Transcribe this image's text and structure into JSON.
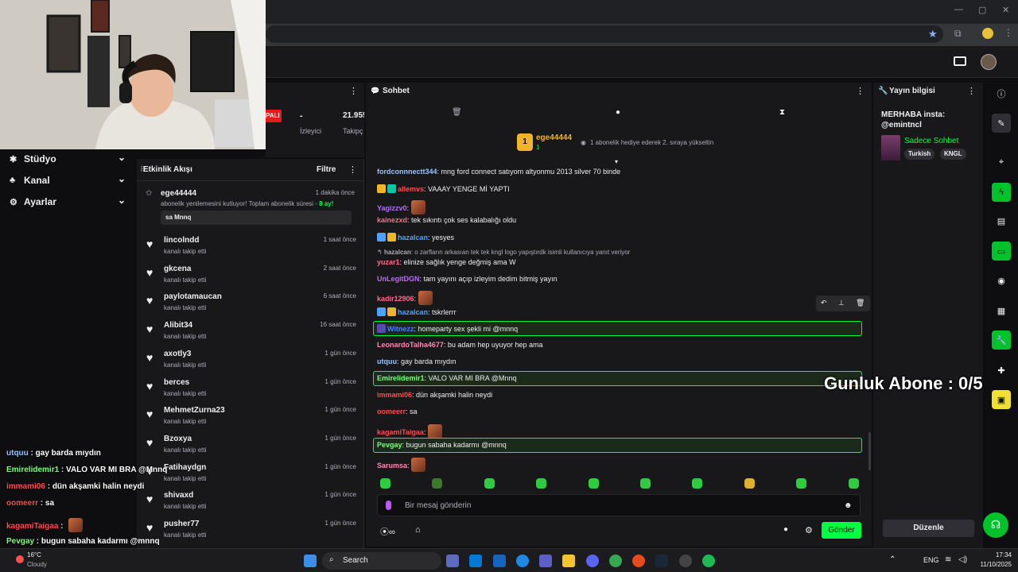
{
  "colors": {
    "accent": "#00ff40",
    "accent_btn": "#00c22a",
    "bg": "#18181b",
    "bg_dark": "#0e0e10"
  },
  "browser": {
    "window_controls": [
      "—",
      "▢",
      "✕"
    ]
  },
  "stats": {
    "live_badge": "PALI",
    "viewers_value": "-",
    "viewers_label": "İzleyici",
    "followers_value": "21.955",
    "followers_label": "Takipç"
  },
  "leftnav": {
    "items": [
      {
        "label": "Stüdyo",
        "icon": "studio-icon"
      },
      {
        "label": "Kanal",
        "icon": "channel-icon"
      },
      {
        "label": "Ayarlar",
        "icon": "gear-icon"
      }
    ]
  },
  "feed": {
    "title": "Etkinlik Akışı",
    "filter_label": "Filtre",
    "sub_event": {
      "name": "ege44444",
      "time": "1 dakika önce",
      "message_prefix": "abonelik yenilemesini kutluyor! Toplam abonelik süresi - ",
      "months": "8 ay!",
      "quote": "sa Mnnq"
    },
    "follows": [
      {
        "name": "lincolndd",
        "sub": "kanalı takip etti",
        "time": "1 saat önce"
      },
      {
        "name": "gkcena",
        "sub": "kanalı takip etti",
        "time": "2 saat önce"
      },
      {
        "name": "paylotamaucan",
        "sub": "kanalı takip etti",
        "time": "6 saat önce"
      },
      {
        "name": "Alibit34",
        "sub": "kanalı takip etti",
        "time": "16 saat önce"
      },
      {
        "name": "axotly3",
        "sub": "kanalı takip etti",
        "time": "1 gün önce"
      },
      {
        "name": "berces",
        "sub": "kanalı takip etti",
        "time": "1 gün önce"
      },
      {
        "name": "MehmetZurna23",
        "sub": "kanalı takip etti",
        "time": "1 gün önce"
      },
      {
        "name": "Bzoxya",
        "sub": "kanalı takip etti",
        "time": "1 gün önce"
      },
      {
        "name": "Fatihaydgn",
        "sub": "kanalı takip etti",
        "time": "1 gün önce"
      },
      {
        "name": "shivaxd",
        "sub": "kanalı takip etti",
        "time": "1 gün önce"
      },
      {
        "name": "pusher77",
        "sub": "kanalı takip etti",
        "time": "1 gün önce"
      }
    ]
  },
  "chat": {
    "title": "Sohbet",
    "gift_banner": {
      "rank": "1",
      "user": "ege44444",
      "count": "1",
      "text": "1 abonelik hediye ederek 2. sıraya yükseltin"
    },
    "messages": [
      {
        "user": "fordconnnectt344",
        "color": "#9cc3ff",
        "text": "mng ford connect satıyom altyonmu 2013 silver 70 binde"
      },
      {
        "user": "allemvs",
        "color": "#ff4d4d",
        "text": "VAAAY YENGE Mİ YAPTI"
      },
      {
        "user": "Yagizzv0",
        "color": "#b86bff",
        "text": ""
      },
      {
        "user": "kainezxd",
        "color": "#ff6b8a",
        "text": "tek sıkıntı çok ses kalabalığı oldu"
      },
      {
        "user": "hazalcan",
        "color": "#4da3ff",
        "text": "yesyes"
      },
      {
        "user": "hazalcan",
        "color": "#adadb8",
        "text": "o zarfların arkasıan tek tek kngl logo yapıştırdk isimli kullanıcıya yanıt veriyor"
      },
      {
        "user": "yuzar1",
        "color": "#ff6b8a",
        "text": "elinize sağlık yenge değmiş ama W"
      },
      {
        "user": "UnLegitDGN",
        "color": "#b86bff",
        "text": "tam yayını açıp izleyim dedim bitmiş yayın"
      },
      {
        "user": "kadir12906",
        "color": "#ff6b8a",
        "text": ""
      },
      {
        "user": "hazalcan",
        "color": "#4da3ff",
        "text": "tskrlerrr"
      },
      {
        "user": "Witnezz",
        "color": "#4d7cff",
        "text": "homeparty sex şekli mi @mnnq"
      },
      {
        "user": "LeonardoTalha4677",
        "color": "#ff8ab0",
        "text": "bu adam hep uyuyor hep ama"
      },
      {
        "user": "utquu",
        "color": "#9cc3ff",
        "text": "gay barda mıydın"
      },
      {
        "user": "Emirelidemir1",
        "color": "#7dff7d",
        "text": "VALO VAR MI BRA @Mnnq"
      },
      {
        "user": "immami06",
        "color": "#ff4d4d",
        "text": "dün akşamki halin neydi"
      },
      {
        "user": "oomeerr",
        "color": "#ff4d4d",
        "text": "sa"
      },
      {
        "user": "kagamiTaigaa",
        "color": "#ff4d4d",
        "text": ""
      },
      {
        "user": "Pevgay",
        "color": "#7dff7d",
        "text": "bugun sabaha kadarmı @mnnq"
      },
      {
        "user": "Sarumsa",
        "color": "#ff8ab0",
        "text": ""
      }
    ],
    "input_placeholder": "Bir mesaj gönderin",
    "send_label": "Gönder"
  },
  "overlay": {
    "sub_counter": "Gunluk Abone : 0/5",
    "lines": [
      {
        "user": "utquu",
        "text": "gay barda mıydın",
        "color": "#9cc3ff"
      },
      {
        "user": "Emirelidemir1",
        "text": "VALO VAR MI BRA @Mnnq",
        "color": "#7dff7d"
      },
      {
        "user": "immami06",
        "text": "dün akşamki halin neydi",
        "color": "#ff4d4d"
      },
      {
        "user": "oomeerr",
        "text": "sa",
        "color": "#ff4d4d"
      },
      {
        "user": "kagamiTaigaa",
        "text": "",
        "color": "#ff4d4d"
      },
      {
        "user": "Pevgay",
        "text": "bugun sabaha kadarmı @mnnq",
        "color": "#7dff7d"
      },
      {
        "user": "Sarumsa",
        "text": "",
        "color": "#ff8ab0"
      }
    ]
  },
  "info": {
    "title": "Yayın bilgisi",
    "stream_title": "MERHABA insta: @emintncl",
    "category": "Sadece Sohbet",
    "tags": [
      "Turkish",
      "KNGL"
    ],
    "edit_label": "Düzenle"
  },
  "taskbar": {
    "weather": "16°C",
    "weather_sub": "Cloudy",
    "search": "Search",
    "lang": "ENG",
    "time": "17:34",
    "date": "11/10/2025"
  }
}
